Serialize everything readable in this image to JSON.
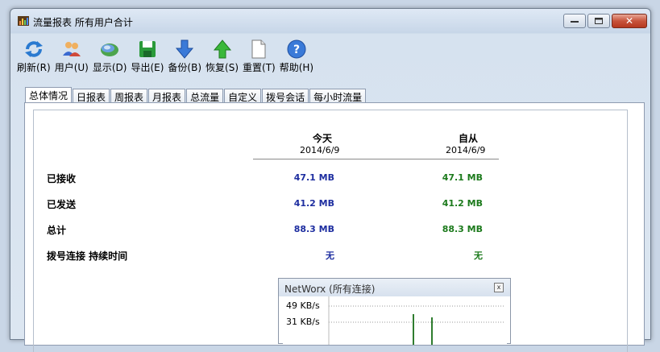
{
  "window": {
    "title": "流量报表 所有用户合计",
    "minimize_label": "▭",
    "maximize_label": "▫",
    "close_label": "✕"
  },
  "toolbar": {
    "items": [
      {
        "label": "刷新(R)",
        "icon": "refresh-icon"
      },
      {
        "label": "用户(U)",
        "icon": "users-icon"
      },
      {
        "label": "显示(D)",
        "icon": "display-icon"
      },
      {
        "label": "导出(E)",
        "icon": "export-icon"
      },
      {
        "label": "备份(B)",
        "icon": "backup-icon"
      },
      {
        "label": "恢复(S)",
        "icon": "restore-icon"
      },
      {
        "label": "重置(T)",
        "icon": "reset-icon"
      },
      {
        "label": "帮助(H)",
        "icon": "help-icon"
      }
    ]
  },
  "tabs": [
    "总体情况",
    "日报表",
    "周报表",
    "月报表",
    "总流量",
    "自定义",
    "拨号会话",
    "每小时流量"
  ],
  "active_tab": 0,
  "summary": {
    "col1_header": "今天",
    "col1_date": "2014/6/9",
    "col2_header": "自从",
    "col2_date": "2014/6/9",
    "rows": [
      {
        "label": "已接收",
        "today": "47.1 MB",
        "since": "47.1 MB"
      },
      {
        "label": "已发送",
        "today": "41.2 MB",
        "since": "41.2 MB"
      },
      {
        "label": "总计",
        "today": "88.3 MB",
        "since": "88.3 MB"
      },
      {
        "label": "拨号连接 持续时间",
        "today": "无",
        "since": "无"
      }
    ]
  },
  "graph": {
    "title": "NetWorx (所有连接)",
    "close_label": "☒",
    "y_labels": [
      "49 KB/s",
      "31 KB/s"
    ]
  },
  "colors": {
    "today_value": "#1e2ea0",
    "since_value": "#1c7a1c",
    "graph_line": "#2f7d2f"
  }
}
